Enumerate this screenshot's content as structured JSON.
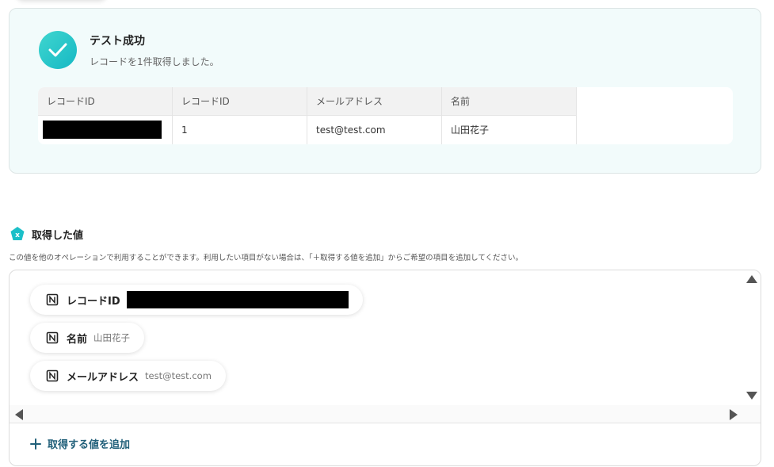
{
  "success": {
    "title": "テスト成功",
    "subtitle": "レコードを1件取得しました。",
    "table": {
      "headers": [
        "レコードID",
        "レコードID",
        "メールアドレス",
        "名前"
      ],
      "row": [
        "",
        "1",
        "test@test.com",
        "山田花子"
      ]
    }
  },
  "acquired": {
    "title": "取得した値",
    "description": "この値を他のオペレーションで利用することができます。利用したい項目がない場合は、「＋取得する値を追加」からご希望の項目を追加してください。",
    "items": [
      {
        "label": "レコードID",
        "value": ""
      },
      {
        "label": "名前",
        "value": "山田花子"
      },
      {
        "label": "メールアドレス",
        "value": "test@test.com"
      }
    ],
    "add_label": "取得する値を追加"
  },
  "colors": {
    "accent_teal": "#1bbfc8",
    "panel_bg": "#f2fbfb",
    "link_dark_teal": "#21607a"
  },
  "icons": {
    "success": "check-icon",
    "section": "variable-icon",
    "item": "notion-icon",
    "add": "plus-icon"
  }
}
